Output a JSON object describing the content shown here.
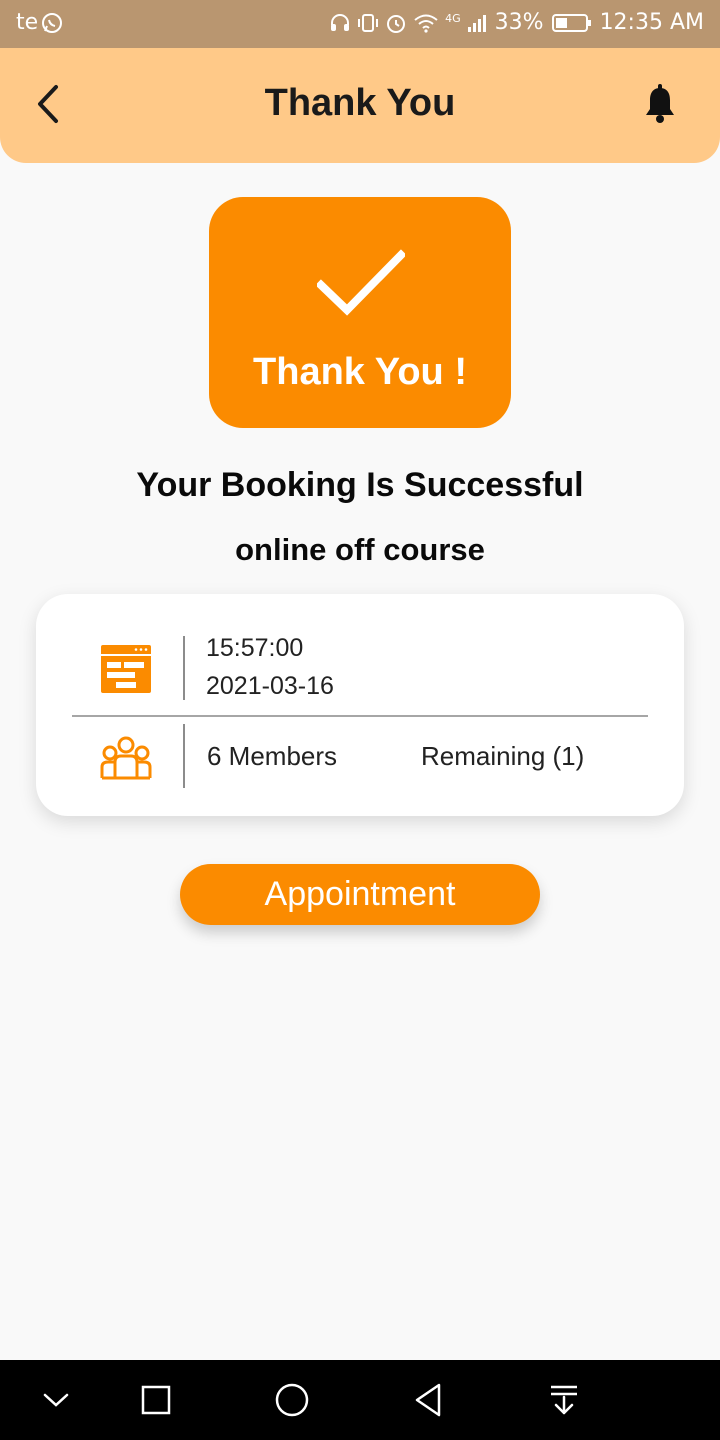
{
  "status_bar": {
    "carrier": "te",
    "battery": "33%",
    "time": "12:35 AM",
    "network": "4G",
    "icons": [
      "whatsapp-icon",
      "headset-icon",
      "vibrate-icon",
      "alarm-icon",
      "wifi-icon",
      "signal-icon",
      "battery-icon"
    ]
  },
  "header": {
    "title": "Thank You",
    "back_icon": "chevron-left-icon",
    "bell_icon": "bell-icon"
  },
  "success_card": {
    "icon": "check-icon",
    "label": "Thank You !"
  },
  "message": {
    "heading": "Your Booking Is Successful",
    "course": "online off course"
  },
  "details": {
    "time": "15:57:00",
    "date": "2021-03-16",
    "members": "6 Members",
    "remaining": "Remaining (1)",
    "schedule_icon": "schedule-icon",
    "members_icon": "group-icon"
  },
  "actions": {
    "appointment_label": "Appointment"
  },
  "nav_bar": {
    "icons": [
      "collapse-icon",
      "recents-icon",
      "home-icon",
      "back-icon",
      "notifications-pull-icon"
    ]
  },
  "colors": {
    "accent": "#fb8b00",
    "header_bg": "#ffc988",
    "status_bar_bg": "#b99670",
    "background": "#f9f9f9"
  }
}
